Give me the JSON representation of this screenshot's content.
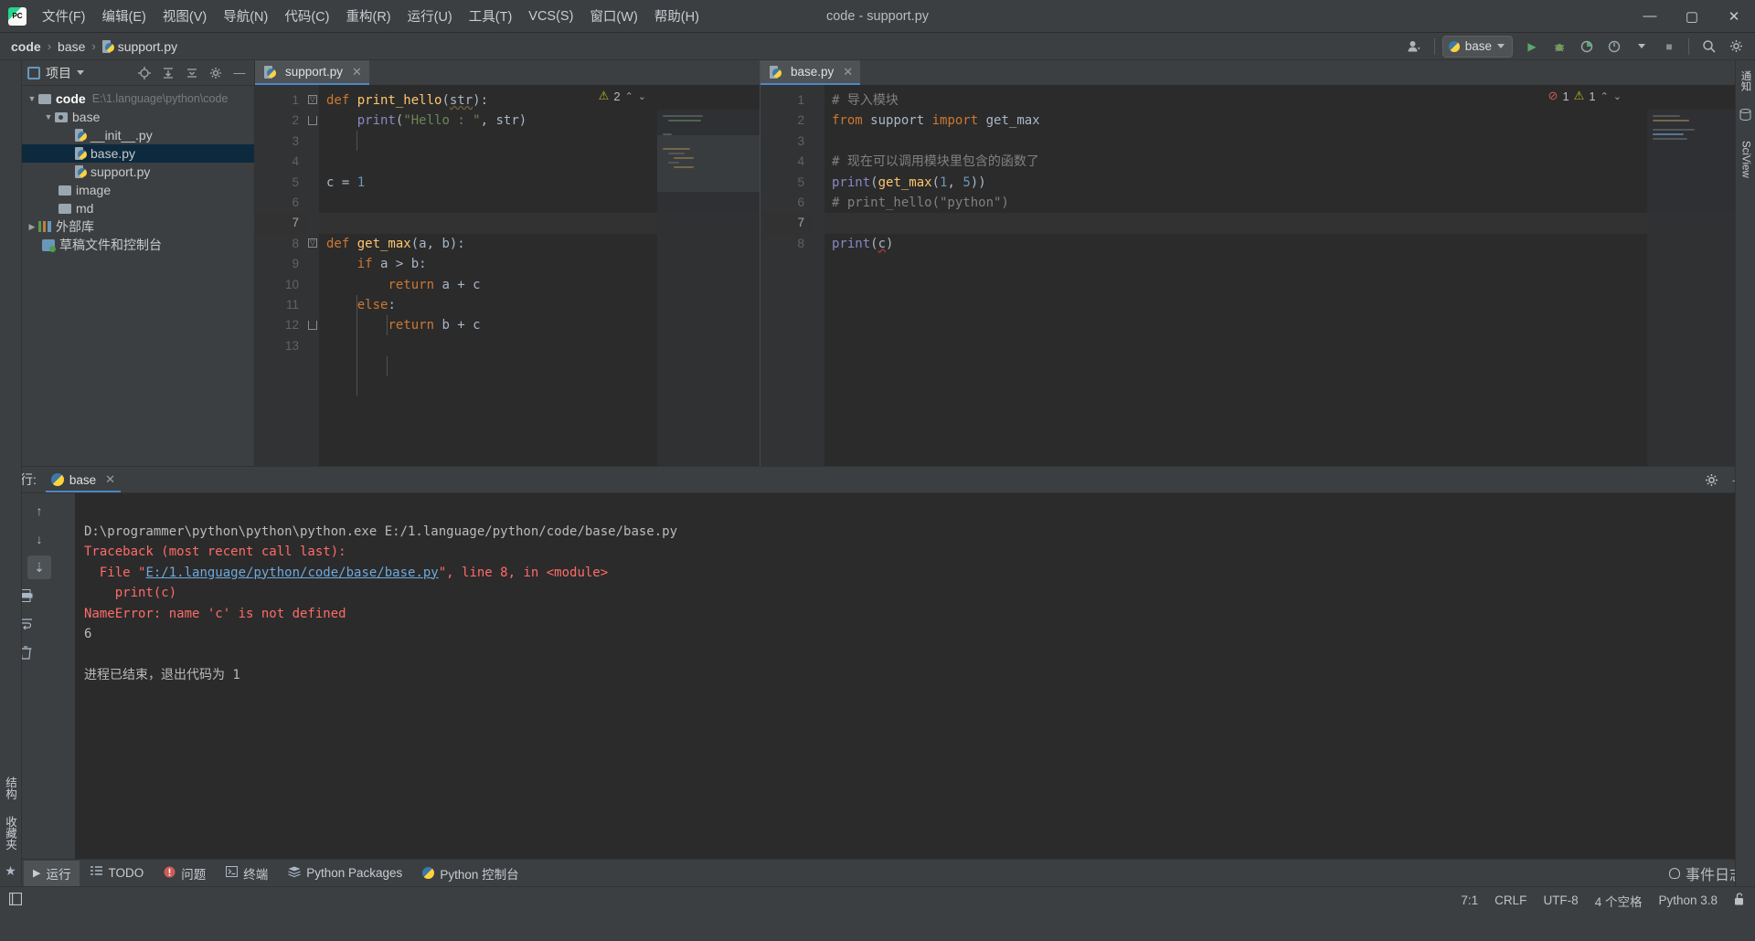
{
  "titlebar": {
    "logo": "pycharm-logo",
    "menus": [
      "文件(F)",
      "编辑(E)",
      "视图(V)",
      "导航(N)",
      "代码(C)",
      "重构(R)",
      "运行(U)",
      "工具(T)",
      "VCS(S)",
      "窗口(W)",
      "帮助(H)"
    ],
    "window_title": "code - support.py",
    "minimize": "—",
    "maximize": "▢",
    "close": "✕"
  },
  "navbar": {
    "crumbs": [
      "code",
      "base",
      "support.py"
    ],
    "separator": "›",
    "run_config": "base",
    "buttons": {
      "account": "account-icon",
      "run": "▶",
      "debug": "debug-icon",
      "run_coverage": "coverage-icon",
      "profile": "profile-icon",
      "stop": "■",
      "search": "search-icon",
      "settings": "gear-icon"
    }
  },
  "left_strip": {
    "project_tab": "项目",
    "structure_tab": "结构",
    "bookmarks_tab": "收藏夹",
    "favorites_star": "★"
  },
  "right_strip": {
    "notifications": "通知",
    "sciview": "SciView"
  },
  "project": {
    "title": "项目",
    "head_buttons": [
      "locate-icon",
      "expand-all-icon",
      "collapse-all-icon",
      "gear-icon",
      "hide-icon"
    ],
    "tree": [
      {
        "label": "code",
        "path": "E:\\1.language\\python\\code",
        "type": "root-folder",
        "depth": 0,
        "expanded": true,
        "selected": false
      },
      {
        "label": "base",
        "path": "",
        "type": "source-folder",
        "depth": 1,
        "expanded": true,
        "selected": false
      },
      {
        "label": "__init__.py",
        "path": "",
        "type": "python-file",
        "depth": 2,
        "expanded": null,
        "selected": false
      },
      {
        "label": "base.py",
        "path": "",
        "type": "python-file",
        "depth": 2,
        "expanded": null,
        "selected": true
      },
      {
        "label": "support.py",
        "path": "",
        "type": "python-file",
        "depth": 2,
        "expanded": null,
        "selected": false
      },
      {
        "label": "image",
        "path": "",
        "type": "folder",
        "depth": 1,
        "expanded": null,
        "selected": false
      },
      {
        "label": "md",
        "path": "",
        "type": "folder",
        "depth": 1,
        "expanded": null,
        "selected": false
      },
      {
        "label": "外部库",
        "path": "",
        "type": "library",
        "depth": 0,
        "expanded": false,
        "selected": false
      },
      {
        "label": "草稿文件和控制台",
        "path": "",
        "type": "scratch",
        "depth": 0,
        "expanded": null,
        "selected": false
      }
    ]
  },
  "editor_left": {
    "tab_name": "support.py",
    "tab_close": "✕",
    "inspection": {
      "warn_icon": "warning-icon",
      "warn_count": "2",
      "up": "⌃",
      "down": "⌄"
    },
    "current_line": 7,
    "lines": [
      {
        "n": 1,
        "tokens": [
          {
            "t": "def ",
            "c": "kw"
          },
          {
            "t": "print_hello",
            "c": "fn"
          },
          {
            "t": "(",
            "c": "plain"
          },
          {
            "t": "str",
            "c": "param-underline"
          },
          {
            "t": "):",
            "c": "plain"
          }
        ],
        "fold": "start"
      },
      {
        "n": 2,
        "tokens": [
          {
            "t": "    ",
            "c": "plain"
          },
          {
            "t": "print",
            "c": "builtin"
          },
          {
            "t": "(",
            "c": "plain"
          },
          {
            "t": "\"Hello : \"",
            "c": "str"
          },
          {
            "t": ", str)",
            "c": "plain"
          }
        ],
        "fold": "end"
      },
      {
        "n": 3,
        "tokens": []
      },
      {
        "n": 4,
        "tokens": []
      },
      {
        "n": 5,
        "tokens": [
          {
            "t": "c = ",
            "c": "plain"
          },
          {
            "t": "1",
            "c": "num"
          }
        ]
      },
      {
        "n": 6,
        "tokens": []
      },
      {
        "n": 7,
        "tokens": []
      },
      {
        "n": 8,
        "tokens": [
          {
            "t": "def ",
            "c": "kw"
          },
          {
            "t": "get_max",
            "c": "fn"
          },
          {
            "t": "(a, b):",
            "c": "plain"
          }
        ],
        "fold": "start"
      },
      {
        "n": 9,
        "tokens": [
          {
            "t": "    ",
            "c": "plain"
          },
          {
            "t": "if ",
            "c": "kw"
          },
          {
            "t": "a > b:",
            "c": "plain"
          }
        ]
      },
      {
        "n": 10,
        "tokens": [
          {
            "t": "        ",
            "c": "plain"
          },
          {
            "t": "return ",
            "c": "kw"
          },
          {
            "t": "a + c",
            "c": "plain"
          }
        ]
      },
      {
        "n": 11,
        "tokens": [
          {
            "t": "    ",
            "c": "plain"
          },
          {
            "t": "else",
            "c": "kw"
          },
          {
            "t": ":",
            "c": "plain"
          }
        ]
      },
      {
        "n": 12,
        "tokens": [
          {
            "t": "        ",
            "c": "plain"
          },
          {
            "t": "return ",
            "c": "kw"
          },
          {
            "t": "b + c",
            "c": "plain"
          }
        ],
        "fold": "end"
      },
      {
        "n": 13,
        "tokens": []
      }
    ]
  },
  "editor_right": {
    "tab_name": "base.py",
    "tab_close": "✕",
    "inspection": {
      "err_icon": "error-icon",
      "err_count": "1",
      "warn_icon": "warning-icon",
      "warn_count": "1",
      "up": "⌃",
      "down": "⌄"
    },
    "current_line": 7,
    "lines": [
      {
        "n": 1,
        "tokens": [
          {
            "t": "# 导入模块",
            "c": "cmt"
          }
        ]
      },
      {
        "n": 2,
        "tokens": [
          {
            "t": "from ",
            "c": "kw"
          },
          {
            "t": "support ",
            "c": "plain"
          },
          {
            "t": "import ",
            "c": "kw"
          },
          {
            "t": "get_max",
            "c": "plain"
          }
        ]
      },
      {
        "n": 3,
        "tokens": []
      },
      {
        "n": 4,
        "tokens": [
          {
            "t": "# 现在可以调用模块里包含的函数了",
            "c": "cmt"
          }
        ]
      },
      {
        "n": 5,
        "tokens": [
          {
            "t": "print",
            "c": "builtin"
          },
          {
            "t": "(",
            "c": "plain"
          },
          {
            "t": "get_max",
            "c": "fn"
          },
          {
            "t": "(",
            "c": "plain"
          },
          {
            "t": "1",
            "c": "num"
          },
          {
            "t": ", ",
            "c": "plain"
          },
          {
            "t": "5",
            "c": "num"
          },
          {
            "t": "))",
            "c": "plain"
          }
        ]
      },
      {
        "n": 6,
        "tokens": [
          {
            "t": "# print_hello(\"python\")",
            "c": "cmt"
          }
        ]
      },
      {
        "n": 7,
        "tokens": []
      },
      {
        "n": 8,
        "tokens": [
          {
            "t": "print",
            "c": "builtin"
          },
          {
            "t": "(",
            "c": "plain"
          },
          {
            "t": "c",
            "c": "err-underline"
          },
          {
            "t": ")",
            "c": "plain"
          }
        ]
      }
    ]
  },
  "run_panel": {
    "label": "运行:",
    "tab_name": "base",
    "tab_close": "✕",
    "settings_icon": "gear-icon",
    "hide_icon": "minimize-icon",
    "toolbar": [
      "rerun-icon",
      "up-icon",
      "wrench-icon",
      "down-icon",
      "stop-icon",
      "wrap-icon",
      "scroll-end-icon",
      "print-icon",
      "soft-wrap-icon",
      "trash-icon"
    ],
    "console": [
      {
        "text": "D:\\programmer\\python\\python\\python.exe E:/1.language/python/code/base/base.py",
        "style": "white"
      },
      {
        "text": "Traceback (most recent call last):",
        "style": "red"
      },
      {
        "prefix": "  File \"",
        "link": "E:/1.language/python/code/base/base.py",
        "suffix": "\", line 8, in <module>",
        "style": "red-link"
      },
      {
        "text": "    print(c)",
        "style": "red"
      },
      {
        "text": "NameError: name 'c' is not defined",
        "style": "red"
      },
      {
        "text": "6",
        "style": "white"
      },
      {
        "text": "",
        "style": "white"
      },
      {
        "text": "进程已结束，退出代码为 1",
        "style": "white"
      }
    ]
  },
  "bottom_bar": {
    "items": [
      {
        "label": "运行",
        "icon": "play-icon",
        "active": true
      },
      {
        "label": "TODO",
        "icon": "todo-icon",
        "active": false
      },
      {
        "label": "问题",
        "icon": "problems-icon",
        "active": false
      },
      {
        "label": "终端",
        "icon": "terminal-icon",
        "active": false
      },
      {
        "label": "Python Packages",
        "icon": "packages-icon",
        "active": false
      },
      {
        "label": "Python 控制台",
        "icon": "python-console-icon",
        "active": false
      }
    ]
  },
  "status_bar": {
    "event_log": "事件日志",
    "event_log_icon": "bell-icon",
    "caret": "7:1",
    "line_sep": "CRLF",
    "encoding": "UTF-8",
    "indent": "4 个空格",
    "interpreter": "Python 3.8",
    "lock_icon": "unlock-icon",
    "left_icon": "layout-icon"
  }
}
